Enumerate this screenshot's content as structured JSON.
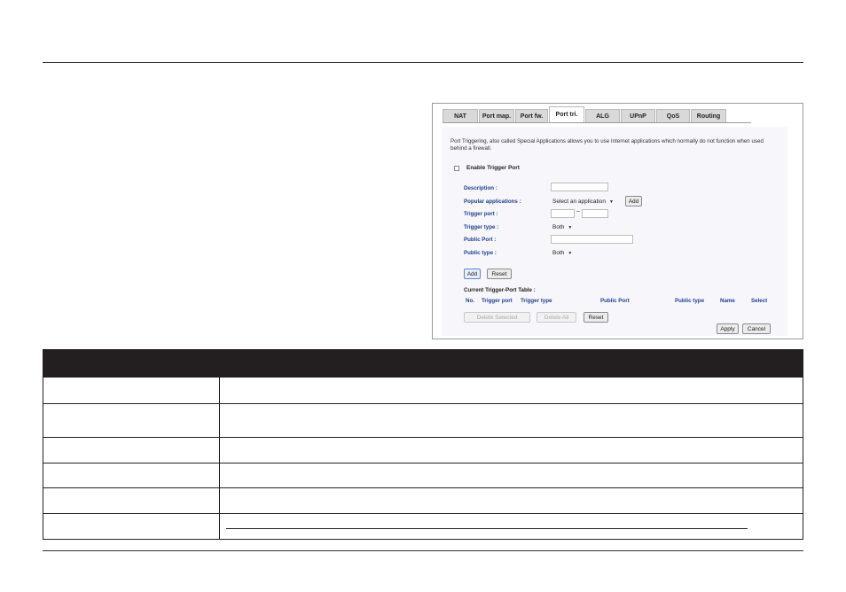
{
  "panel": {
    "tabs": [
      {
        "label": "NAT"
      },
      {
        "label": "Port map."
      },
      {
        "label": "Port fw."
      },
      {
        "label": "Port tri."
      },
      {
        "label": "ALG"
      },
      {
        "label": "UPnP"
      },
      {
        "label": "QoS"
      },
      {
        "label": "Routing"
      }
    ],
    "active_tab": "Port tri.",
    "intro": "Port Triggering, also called Special Applications allows you to use Internet applications which normally do not function when used behind a firewall.",
    "enable_label": "Enable Trigger Port",
    "enable_checked": false,
    "fields": {
      "description_label": "Description :",
      "popular_label": "Popular applications :",
      "popular_value": "Select an application",
      "popular_add": "Add",
      "trigger_port_label": "Trigger port :",
      "trigger_port_sep": "–",
      "trigger_type_label": "Trigger type :",
      "trigger_type_value": "Both",
      "public_port_label": "Public Port :",
      "public_type_label": "Public type :",
      "public_type_value": "Both"
    },
    "buttons": {
      "add": "Add",
      "reset": "Reset"
    },
    "table": {
      "title": "Current Trigger-Port Table :",
      "columns": [
        "No.",
        "Trigger port",
        "Trigger type",
        "Public Port",
        "Public type",
        "Name",
        "Select"
      ]
    },
    "table_buttons": {
      "delete_selected": "Delete Selected",
      "delete_all": "Delete All",
      "reset": "Reset"
    },
    "footer_buttons": {
      "apply": "Apply",
      "cancel": "Cancel"
    }
  },
  "doc_table": {
    "rows": 6
  }
}
